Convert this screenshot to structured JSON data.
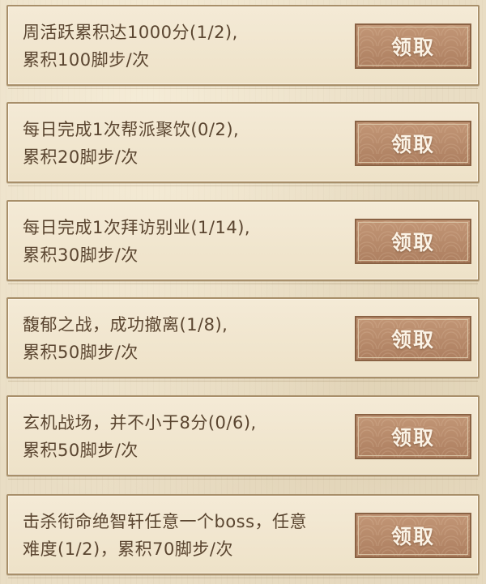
{
  "tasks": [
    {
      "line1": "周活跃累积达1000分(1/2),",
      "line2": "累积100脚步/次",
      "button_label": "领取"
    },
    {
      "line1": "每日完成1次帮派聚饮(0/2),",
      "line2": "累积20脚步/次",
      "button_label": "领取"
    },
    {
      "line1": "每日完成1次拜访别业(1/14),",
      "line2": "累积30脚步/次",
      "button_label": "领取"
    },
    {
      "line1": "馥郁之战，成功撤离(1/8),",
      "line2": "累积50脚步/次",
      "button_label": "领取"
    },
    {
      "line1": "玄机战场，并不小于8分(0/6),",
      "line2": "累积50脚步/次",
      "button_label": "领取"
    },
    {
      "line1": "击杀衔命绝智轩任意一个boss，任意",
      "line2": "难度(1/2)，累积70脚步/次",
      "button_label": "领取"
    }
  ]
}
